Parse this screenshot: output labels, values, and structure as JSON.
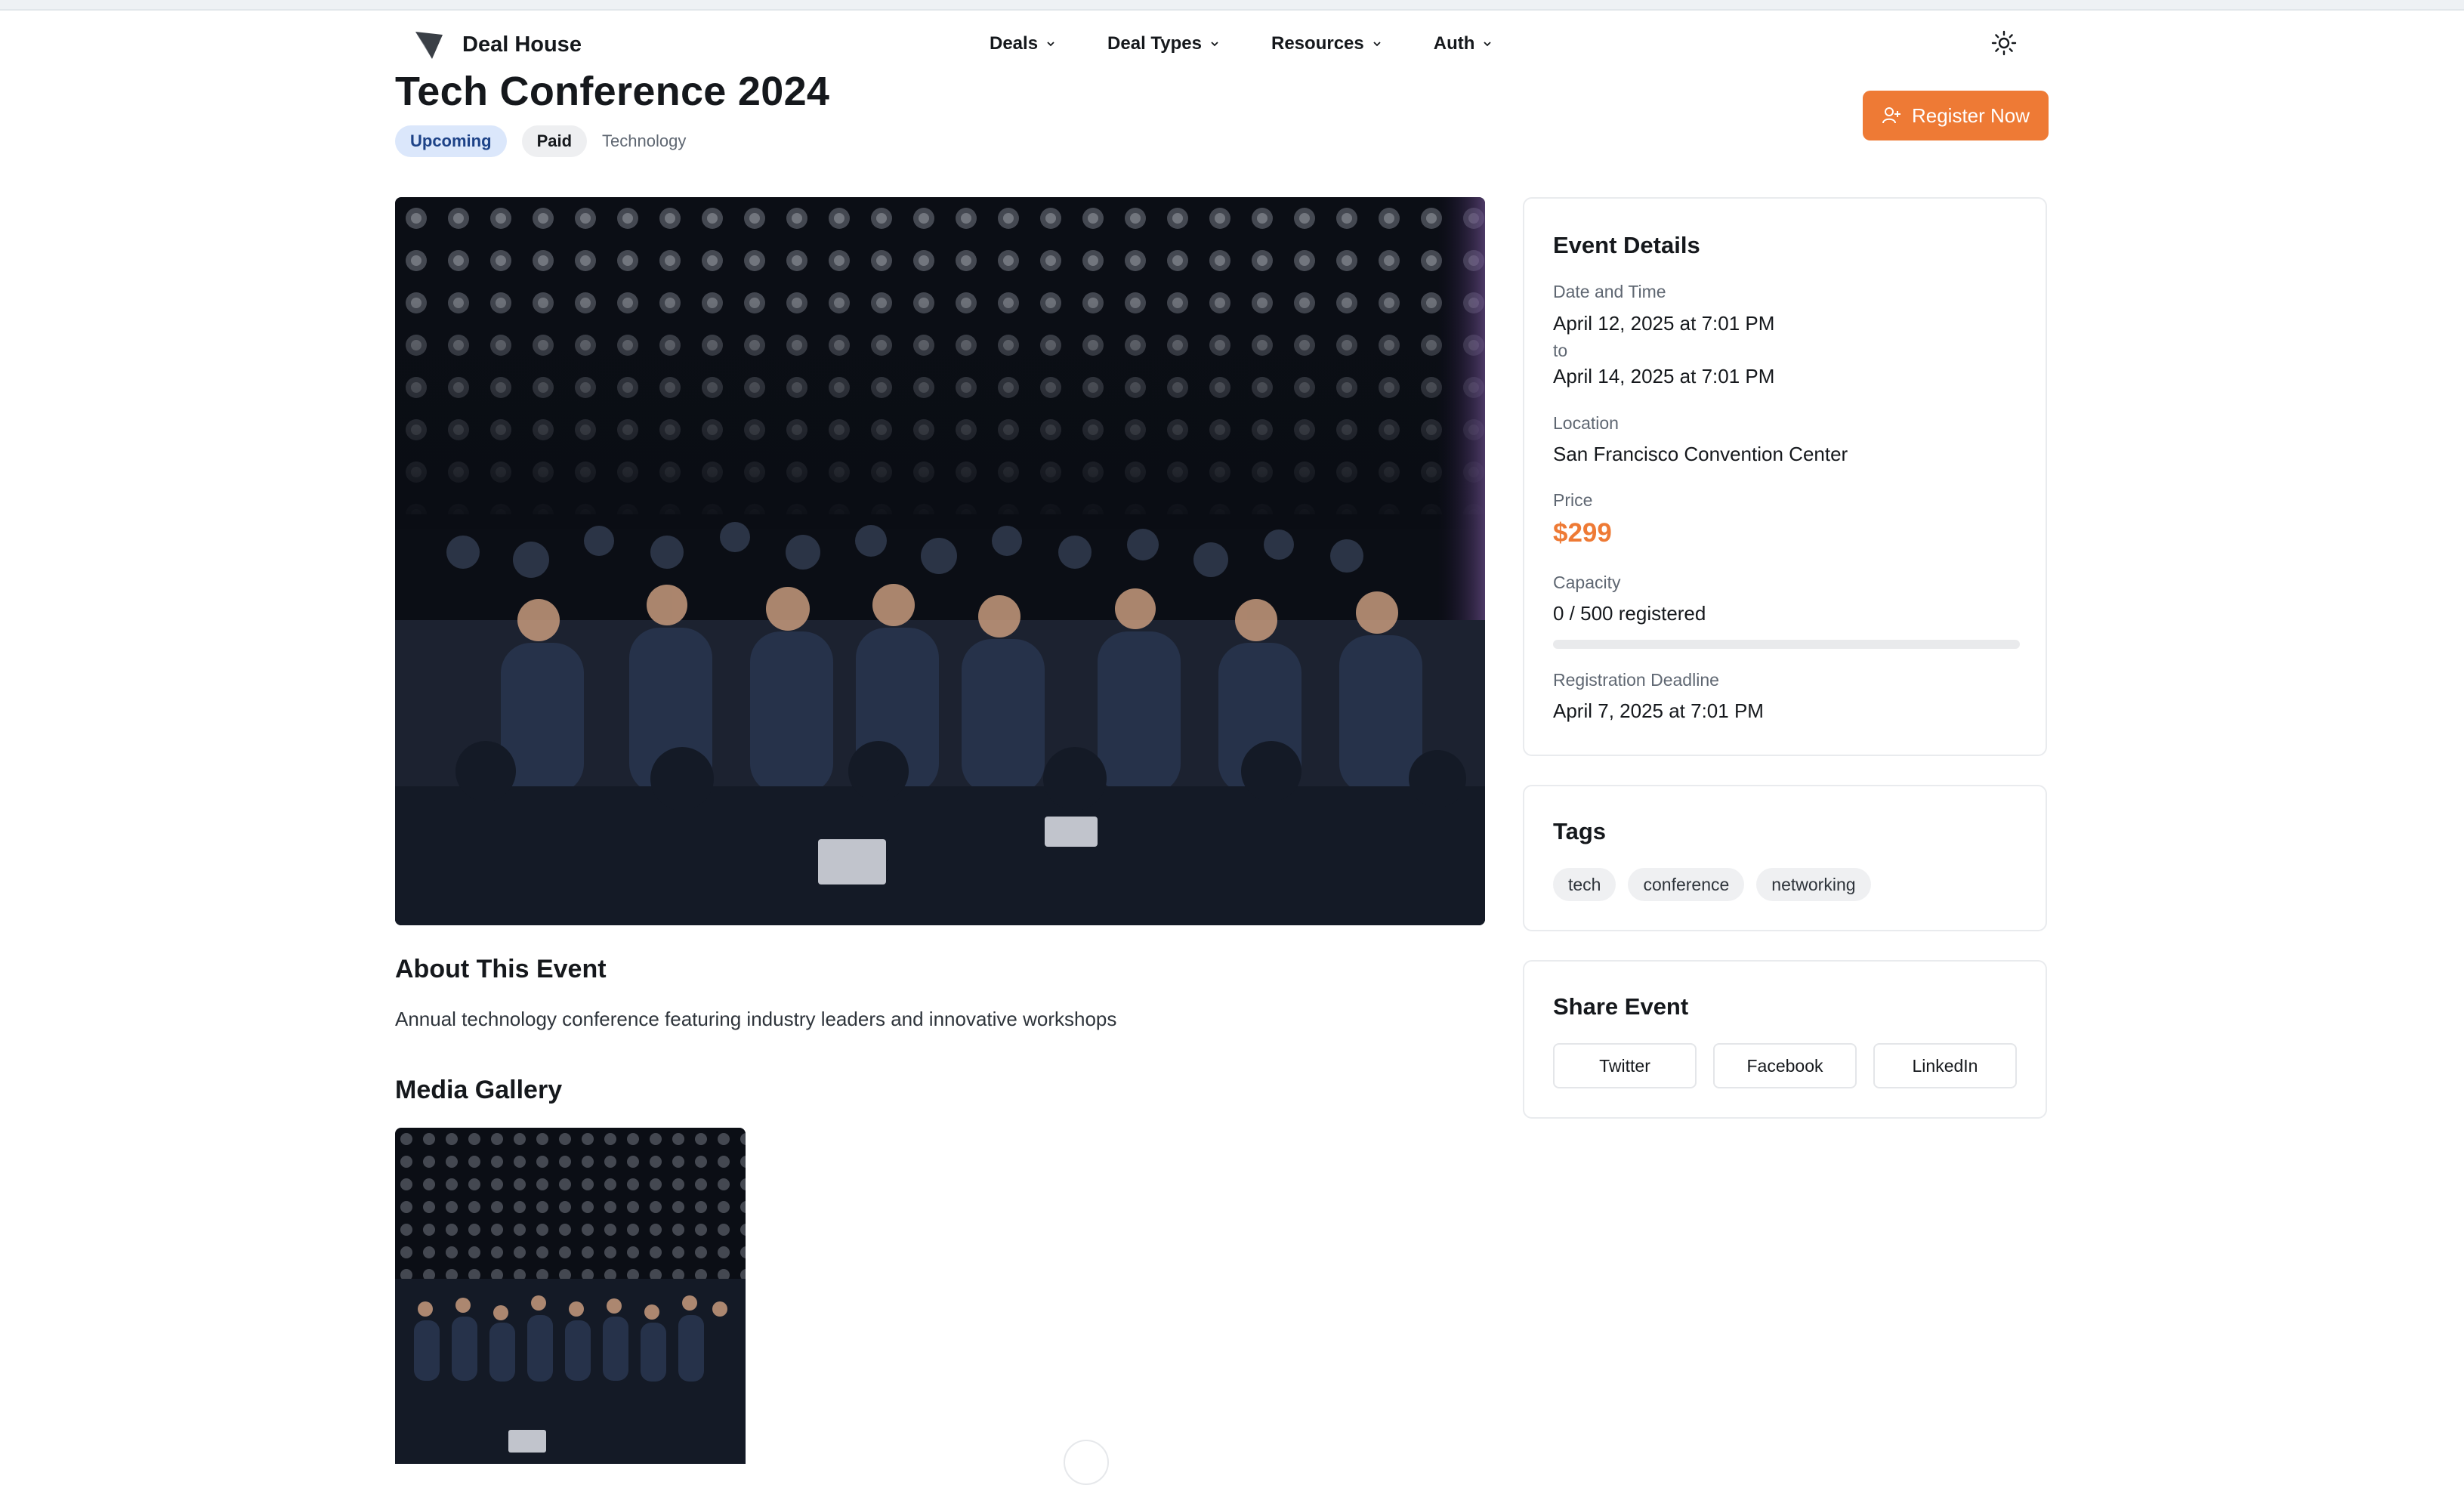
{
  "brand": {
    "name": "Deal House"
  },
  "nav": {
    "items": [
      {
        "label": "Deals"
      },
      {
        "label": "Deal Types"
      },
      {
        "label": "Resources"
      },
      {
        "label": "Auth"
      }
    ],
    "theme_icon": "sun-icon",
    "chevron_icon": "chevron-down-icon"
  },
  "event": {
    "title": "Tech Conference 2024",
    "status": "Upcoming",
    "pricing_type": "Paid",
    "category": "Technology",
    "register_label": "Register Now",
    "register_icon": "user-plus-icon",
    "hero_image": "conference-audience-photo",
    "about_heading": "About This Event",
    "description": "Annual technology conference featuring industry leaders and innovative workshops",
    "gallery_heading": "Media Gallery"
  },
  "details": {
    "heading": "Event Details",
    "date_label": "Date and Time",
    "start": "April 12, 2025 at 7:01 PM",
    "to": "to",
    "end": "April 14, 2025 at 7:01 PM",
    "location_label": "Location",
    "location": "San Francisco Convention Center",
    "price_label": "Price",
    "price": "$299",
    "capacity_label": "Capacity",
    "capacity_text": "0 / 500 registered",
    "registered": 0,
    "capacity": 500,
    "capacity_fraction": 0.0,
    "deadline_label": "Registration Deadline",
    "deadline": "April 7, 2025 at 7:01 PM"
  },
  "tags": {
    "heading": "Tags",
    "items": [
      "tech",
      "conference",
      "networking"
    ]
  },
  "share": {
    "heading": "Share Event",
    "twitter": "Twitter",
    "facebook": "Facebook",
    "linkedin": "LinkedIn"
  },
  "colors": {
    "accent": "#ee7a35",
    "badge_upcoming_bg": "#dbe7fb",
    "badge_upcoming_text": "#1d4287"
  }
}
